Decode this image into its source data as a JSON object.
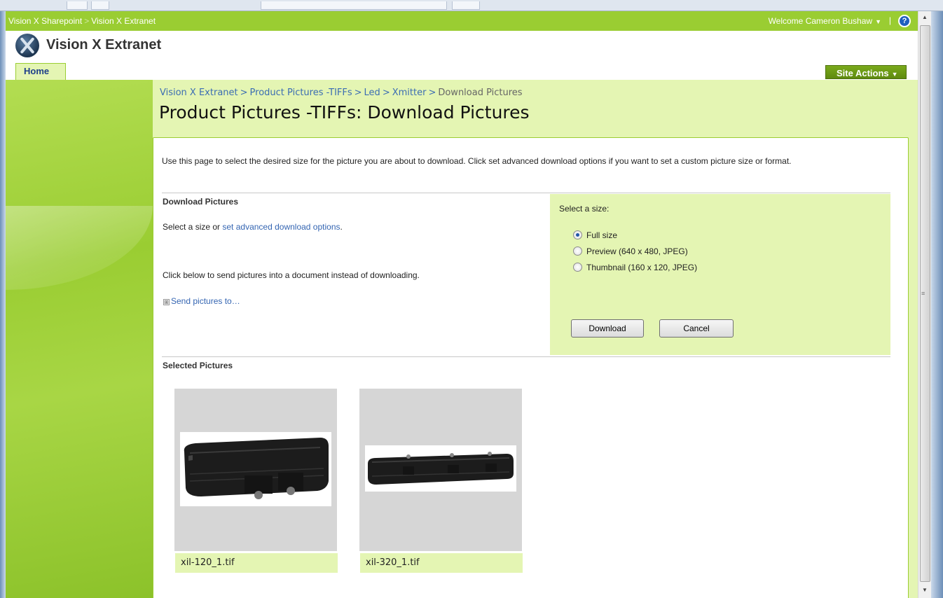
{
  "global_bar": {
    "crumbs": [
      "Vision X Sharepoint",
      "Vision X Extranet"
    ],
    "crumb_sep": ">",
    "welcome": "Welcome Cameron Bushaw",
    "help_glyph": "?"
  },
  "site": {
    "title": "Vision X Extranet",
    "home_tab": "Home",
    "site_actions": "Site Actions"
  },
  "breadcrumb": {
    "items": [
      "Vision X Extranet",
      "Product Pictures -TIFFs",
      "Led",
      "Xmitter",
      "Download Pictures"
    ],
    "sep": ">"
  },
  "page_title": "Product Pictures -TIFFs: Download Pictures",
  "intro": "Use this page to select the desired size for the picture you are about to download. Click set advanced download options if you want to set a custom picture size or format.",
  "download_section": {
    "title": "Download Pictures",
    "select_prefix": "Select a size or ",
    "advanced_link": "set advanced download options",
    "select_suffix": ".",
    "send_desc": "Click below to send pictures into a document instead of downloading.",
    "send_link": "Send pictures to…",
    "send_box_glyph": "⊞"
  },
  "size_panel": {
    "label": "Select a size:",
    "options": [
      {
        "label": "Full size",
        "selected": true
      },
      {
        "label": "Preview (640 x 480, JPEG)",
        "selected": false
      },
      {
        "label": "Thumbnail (160 x 120, JPEG)",
        "selected": false
      }
    ],
    "download_button": "Download",
    "cancel_button": "Cancel"
  },
  "selected_section": {
    "title": "Selected Pictures",
    "pictures": [
      {
        "filename": "xil-120_1.tif"
      },
      {
        "filename": "xil-320_1.tif"
      }
    ]
  },
  "colors": {
    "brand_green": "#9acd32",
    "light_green": "#e4f5b3",
    "link_blue": "#3465b2"
  }
}
